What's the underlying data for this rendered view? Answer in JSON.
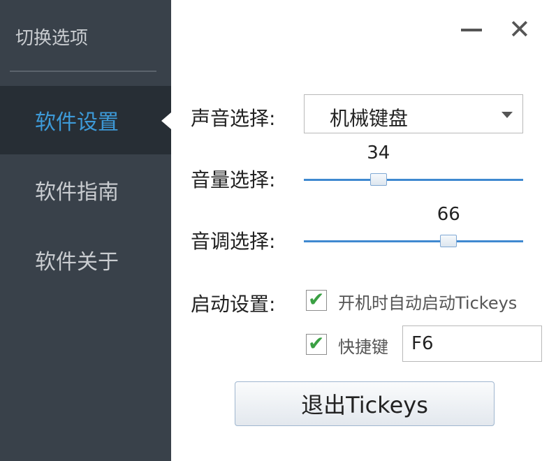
{
  "sidebar": {
    "header": "切换选项",
    "items": [
      {
        "label": "软件设置",
        "active": true
      },
      {
        "label": "软件指南",
        "active": false
      },
      {
        "label": "软件关于",
        "active": false
      }
    ]
  },
  "window": {
    "minimize_icon": "minimize-icon",
    "close_glyph": "✕"
  },
  "settings": {
    "sound_label": "声音选择:",
    "sound_value": "机械键盘",
    "volume_label": "音量选择:",
    "volume_value": "34",
    "pitch_label": "音调选择:",
    "pitch_value": "66",
    "startup_label": "启动设置:",
    "autostart_label": "开机时自动启动Tickeys",
    "autostart_checked": true,
    "hotkey_label": "快捷键",
    "hotkey_checked": true,
    "hotkey_value": "F6",
    "check_glyph": "✔"
  },
  "exit_button": "退出Tickeys",
  "colors": {
    "sidebar_bg": "#39414a",
    "sidebar_active_bg": "#272e35",
    "accent": "#3d9ad8",
    "check": "#3aa043"
  }
}
